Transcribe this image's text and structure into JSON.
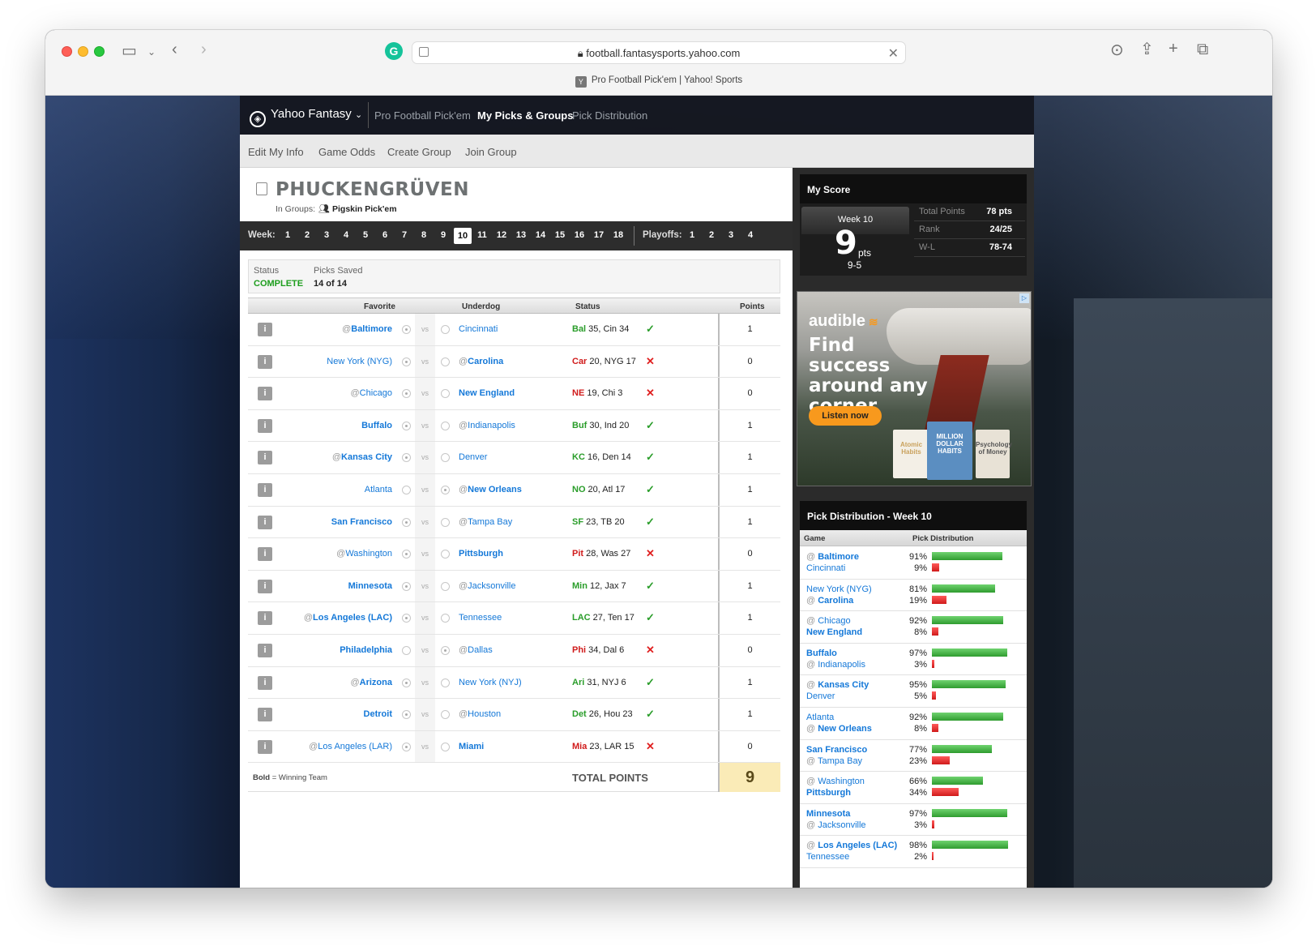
{
  "browser": {
    "url": "football.fantasysports.yahoo.com",
    "tab_title": "Pro Football Pick'em | Yahoo! Sports",
    "tab_favicon": "Y"
  },
  "nav": {
    "brand": "Yahoo Fantasy",
    "links": [
      "Pro Football Pick'em",
      "My Picks & Groups",
      "Pick Distribution"
    ],
    "active": "My Picks & Groups"
  },
  "subnav": [
    "Edit My Info",
    "Game Odds",
    "Create Group",
    "Join Group"
  ],
  "team": {
    "name": "PHUCKENGRÜVEN",
    "groups_label": "In Groups:",
    "group": "Pigskin Pick'em"
  },
  "weeks": {
    "label": "Week:",
    "list": [
      "1",
      "2",
      "3",
      "4",
      "5",
      "6",
      "7",
      "8",
      "9",
      "10",
      "11",
      "12",
      "13",
      "14",
      "15",
      "16",
      "17",
      "18"
    ],
    "current": "10",
    "playoffs_label": "Playoffs:",
    "playoffs": [
      "1",
      "2",
      "3",
      "4"
    ]
  },
  "status": {
    "status_label": "Status",
    "status_value": "COMPLETE",
    "picks_label": "Picks Saved",
    "picks_value": "14 of 14"
  },
  "picks_table": {
    "headers": {
      "favorite": "Favorite",
      "underdog": "Underdog",
      "status": "Status",
      "points": "Points"
    },
    "rows": [
      {
        "fav_at": "@",
        "fav": "Baltimore",
        "fav_bold": true,
        "und_at": "",
        "und": "Cincinnati",
        "und_bold": false,
        "pick": "fav",
        "stat_w": "Bal",
        "stat_rest": " 35, Cin 34",
        "result": "win",
        "points": "1"
      },
      {
        "fav_at": "",
        "fav": "New York (NYG)",
        "fav_bold": false,
        "und_at": "@",
        "und": "Carolina",
        "und_bold": true,
        "pick": "fav",
        "stat_w": "Car",
        "stat_rest": " 20, NYG 17",
        "result": "loss",
        "points": "0"
      },
      {
        "fav_at": "@",
        "fav": "Chicago",
        "fav_bold": false,
        "und_at": "",
        "und": "New England",
        "und_bold": true,
        "pick": "fav",
        "stat_w": "NE",
        "stat_rest": " 19, Chi 3",
        "result": "loss",
        "points": "0"
      },
      {
        "fav_at": "",
        "fav": "Buffalo",
        "fav_bold": true,
        "und_at": "@",
        "und": "Indianapolis",
        "und_bold": false,
        "pick": "fav",
        "stat_w": "Buf",
        "stat_rest": " 30, Ind 20",
        "result": "win",
        "points": "1"
      },
      {
        "fav_at": "@",
        "fav": "Kansas City",
        "fav_bold": true,
        "und_at": "",
        "und": "Denver",
        "und_bold": false,
        "pick": "fav",
        "stat_w": "KC",
        "stat_rest": " 16, Den 14",
        "result": "win",
        "points": "1"
      },
      {
        "fav_at": "",
        "fav": "Atlanta",
        "fav_bold": false,
        "und_at": "@",
        "und": "New Orleans",
        "und_bold": true,
        "pick": "und",
        "stat_w": "NO",
        "stat_rest": " 20, Atl 17",
        "result": "win",
        "points": "1"
      },
      {
        "fav_at": "",
        "fav": "San Francisco",
        "fav_bold": true,
        "und_at": "@",
        "und": "Tampa Bay",
        "und_bold": false,
        "pick": "fav",
        "stat_w": "SF",
        "stat_rest": " 23, TB 20",
        "result": "win",
        "points": "1"
      },
      {
        "fav_at": "@",
        "fav": "Washington",
        "fav_bold": false,
        "und_at": "",
        "und": "Pittsburgh",
        "und_bold": true,
        "pick": "fav",
        "stat_w": "Pit",
        "stat_rest": " 28, Was 27",
        "result": "loss",
        "points": "0"
      },
      {
        "fav_at": "",
        "fav": "Minnesota",
        "fav_bold": true,
        "und_at": "@",
        "und": "Jacksonville",
        "und_bold": false,
        "pick": "fav",
        "stat_w": "Min",
        "stat_rest": " 12, Jax 7",
        "result": "win",
        "points": "1"
      },
      {
        "fav_at": "@",
        "fav": "Los Angeles (LAC)",
        "fav_bold": true,
        "und_at": "",
        "und": "Tennessee",
        "und_bold": false,
        "pick": "fav",
        "stat_w": "LAC",
        "stat_rest": " 27, Ten 17",
        "result": "win",
        "points": "1"
      },
      {
        "fav_at": "",
        "fav": "Philadelphia",
        "fav_bold": true,
        "und_at": "@",
        "und": "Dallas",
        "und_bold": false,
        "pick": "und",
        "stat_w": "Phi",
        "stat_rest": " 34, Dal 6",
        "result": "loss",
        "points": "0"
      },
      {
        "fav_at": "@",
        "fav": "Arizona",
        "fav_bold": true,
        "und_at": "",
        "und": "New York (NYJ)",
        "und_bold": false,
        "pick": "fav",
        "stat_w": "Ari",
        "stat_rest": " 31, NYJ 6",
        "result": "win",
        "points": "1"
      },
      {
        "fav_at": "",
        "fav": "Detroit",
        "fav_bold": true,
        "und_at": "@",
        "und": "Houston",
        "und_bold": false,
        "pick": "fav",
        "stat_w": "Det",
        "stat_rest": " 26, Hou 23",
        "result": "win",
        "points": "1"
      },
      {
        "fav_at": "@",
        "fav": "Los Angeles (LAR)",
        "fav_bold": false,
        "und_at": "",
        "und": "Miami",
        "und_bold": true,
        "pick": "fav",
        "stat_w": "Mia",
        "stat_rest": " 23, LAR 15",
        "result": "loss",
        "points": "0"
      }
    ],
    "vs": "vs",
    "legend_bold": "Bold",
    "legend_rest": " = Winning Team",
    "total_label": "TOTAL POINTS",
    "total_value": "9"
  },
  "my_score": {
    "title": "My Score",
    "week": "Week 10",
    "points": "9",
    "pts_label": "pts",
    "wl": "9-5",
    "stats": [
      {
        "label": "Total Points",
        "value": "78 pts"
      },
      {
        "label": "Rank",
        "value": "24/25"
      },
      {
        "label": "W-L",
        "value": "78-74"
      }
    ]
  },
  "ad": {
    "brand": "audible",
    "headline": "Find success around any corner",
    "cta": "Listen now",
    "books": [
      "Atomic Habits",
      "MILLION DOLLAR HABITS",
      "Psychology of Money"
    ]
  },
  "pick_distribution": {
    "title": "Pick Distribution - Week 10",
    "col_game": "Game",
    "col_dist": "Pick Distribution",
    "rows": [
      {
        "t1_at": "@",
        "t1": "Baltimore",
        "t1_bold": true,
        "t2_at": "",
        "t2": "Cincinnati",
        "t2_bold": false,
        "p1": 91,
        "p2": 9
      },
      {
        "t1_at": "",
        "t1": "New York (NYG)",
        "t1_bold": false,
        "t2_at": "@",
        "t2": "Carolina",
        "t2_bold": true,
        "p1": 81,
        "p2": 19
      },
      {
        "t1_at": "@",
        "t1": "Chicago",
        "t1_bold": false,
        "t2_at": "",
        "t2": "New England",
        "t2_bold": true,
        "p1": 92,
        "p2": 8
      },
      {
        "t1_at": "",
        "t1": "Buffalo",
        "t1_bold": true,
        "t2_at": "@",
        "t2": "Indianapolis",
        "t2_bold": false,
        "p1": 97,
        "p2": 3
      },
      {
        "t1_at": "@",
        "t1": "Kansas City",
        "t1_bold": true,
        "t2_at": "",
        "t2": "Denver",
        "t2_bold": false,
        "p1": 95,
        "p2": 5
      },
      {
        "t1_at": "",
        "t1": "Atlanta",
        "t1_bold": false,
        "t2_at": "@",
        "t2": "New Orleans",
        "t2_bold": true,
        "p1": 92,
        "p2": 8
      },
      {
        "t1_at": "",
        "t1": "San Francisco",
        "t1_bold": true,
        "t2_at": "@",
        "t2": "Tampa Bay",
        "t2_bold": false,
        "p1": 77,
        "p2": 23
      },
      {
        "t1_at": "@",
        "t1": "Washington",
        "t1_bold": false,
        "t2_at": "",
        "t2": "Pittsburgh",
        "t2_bold": true,
        "p1": 66,
        "p2": 34
      },
      {
        "t1_at": "",
        "t1": "Minnesota",
        "t1_bold": true,
        "t2_at": "@",
        "t2": "Jacksonville",
        "t2_bold": false,
        "p1": 97,
        "p2": 3
      },
      {
        "t1_at": "@",
        "t1": "Los Angeles (LAC)",
        "t1_bold": true,
        "t2_at": "",
        "t2": "Tennessee",
        "t2_bold": false,
        "p1": 98,
        "p2": 2
      }
    ]
  },
  "colors": {
    "link": "#1478d8",
    "win_text": "#2a9d2a",
    "loss_text": "#d01b1b",
    "status_complete": "#1e9e1e",
    "check": "#2a9d2a",
    "cross": "#e02020",
    "ad_orange": "#f8991d"
  },
  "icons": {
    "result_win": "✓",
    "result_loss": "✕",
    "info": "i"
  }
}
